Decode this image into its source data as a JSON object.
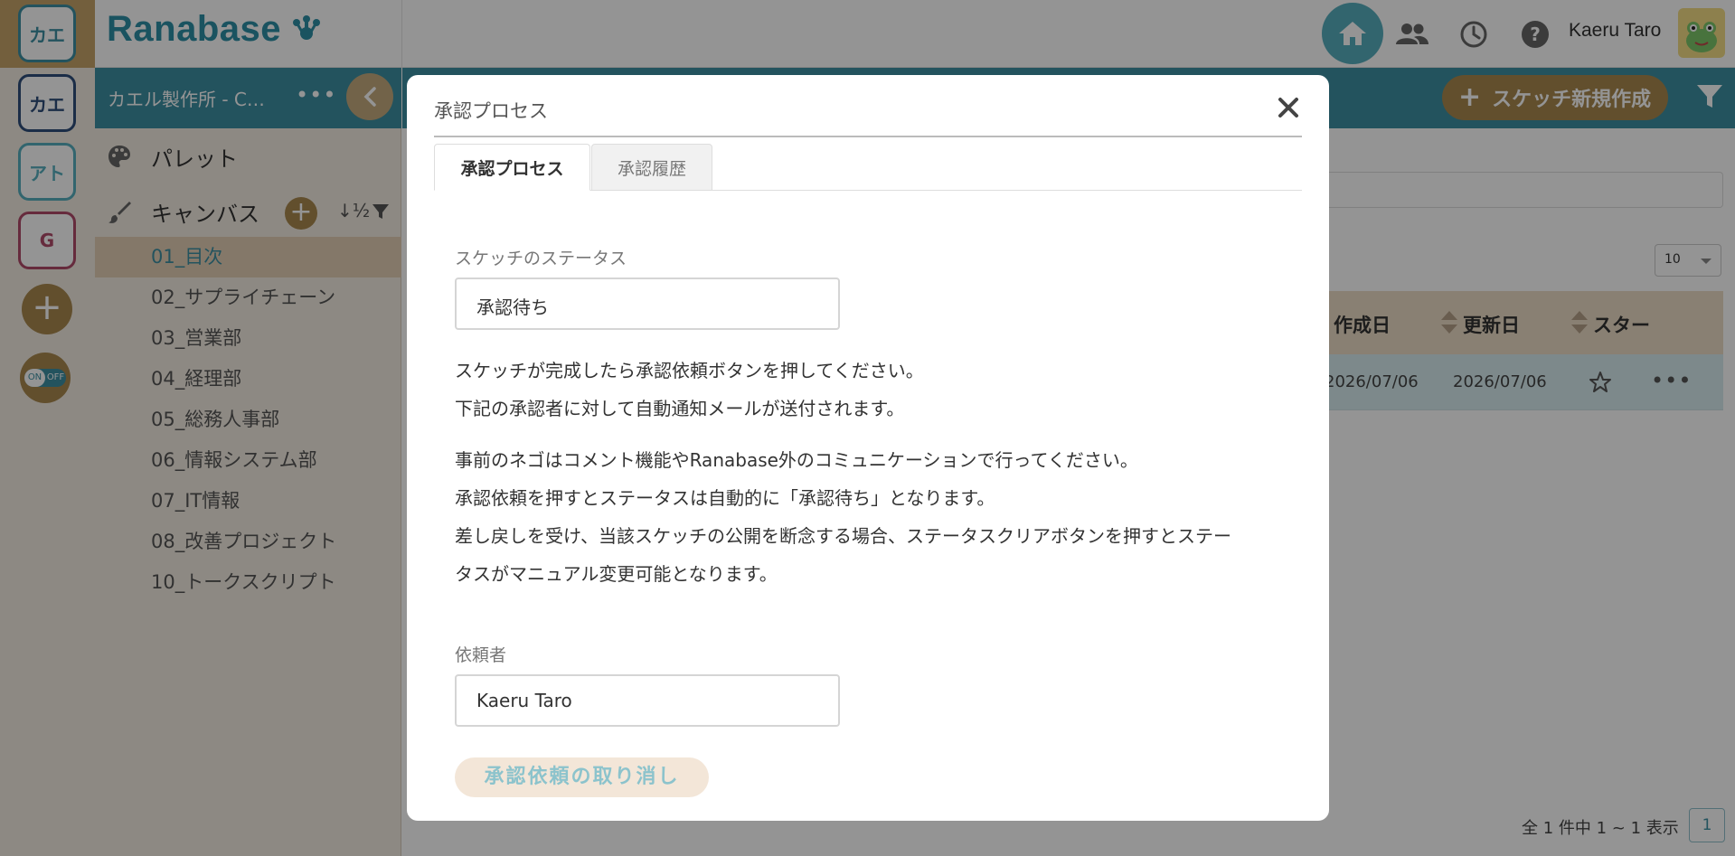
{
  "app": {
    "logo_text": "Ranabase",
    "user_name": "Kaeru Taro"
  },
  "workspaces": [
    {
      "label": "カエ",
      "color": "#3d8fa3"
    },
    {
      "label": "カエ",
      "color": "#2f4f7a"
    },
    {
      "label": "アト",
      "color": "#57aebd"
    },
    {
      "label": "G",
      "color": "#b04a6a"
    }
  ],
  "toggle": {
    "on": "ON",
    "off": "OFF"
  },
  "sidebar": {
    "project_name": "カエル製作所 - C…",
    "more": "•••",
    "palette_label": "パレット",
    "canvas_label": "キャンバス",
    "canvases": [
      "01_目次",
      "02_サプライチェーン",
      "03_営業部",
      "04_経理部",
      "05_総務人事部",
      "06_情報システム部",
      "07_IT情報",
      "08_改善プロジェクト",
      "10_トークスクリプト"
    ]
  },
  "main": {
    "new_sketch_label": "スケッチ新規作成",
    "page_size": "10",
    "columns": {
      "created": "作成日",
      "updated": "更新日",
      "star": "スター"
    },
    "row": {
      "created": "2026/07/06",
      "updated": "2026/07/06",
      "more": "•••"
    },
    "pager_info": "全 1 件中 1 ~ 1 表示",
    "pager_page": "1"
  },
  "modal": {
    "title": "承認プロセス",
    "tabs": {
      "process": "承認プロセス",
      "history": "承認履歴"
    },
    "status_label": "スケッチのステータス",
    "status_value": "承認待ち",
    "para1": [
      "スケッチが完成したら承認依頼ボタンを押してください。",
      "下記の承認者に対して自動通知メールが送付されます。"
    ],
    "para2": [
      "事前のネゴはコメント機能やRanabase外のコミュニケーションで行ってください。",
      "承認依頼を押すとステータスは自動的に「承認待ち」となります。",
      "差し戻しを受け、当該スケッチの公開を断念する場合、ステータスクリアボタンを押すとステー",
      "タスがマニュアル変更可能となります。"
    ],
    "requester_label": "依頼者",
    "requester_value": "Kaeru Taro",
    "cancel_button": "承認依頼の取り消し"
  }
}
